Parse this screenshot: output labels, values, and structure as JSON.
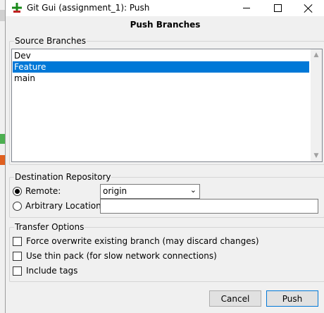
{
  "window": {
    "title": "Git Gui (assignment_1): Push",
    "controls": [
      "minimize",
      "maximize",
      "close"
    ]
  },
  "heading": "Push Branches",
  "source_branches": {
    "label": "Source Branches",
    "items": [
      "Dev",
      "Feature",
      "main"
    ],
    "selected": "Feature"
  },
  "destination": {
    "label": "Destination Repository",
    "remote_label": "Remote:",
    "remote_value": "origin",
    "arbitrary_label": "Arbitrary Location:",
    "arbitrary_value": "",
    "selected": "remote"
  },
  "transfer_options": {
    "label": "Transfer Options",
    "options": [
      {
        "label": "Force overwrite existing branch (may discard changes)",
        "checked": false
      },
      {
        "label": "Use thin pack (for slow network connections)",
        "checked": false
      },
      {
        "label": "Include tags",
        "checked": false
      }
    ]
  },
  "buttons": {
    "cancel": "Cancel",
    "push": "Push"
  },
  "colors": {
    "selection": "#0078d7",
    "push_border": "#0078d7"
  }
}
